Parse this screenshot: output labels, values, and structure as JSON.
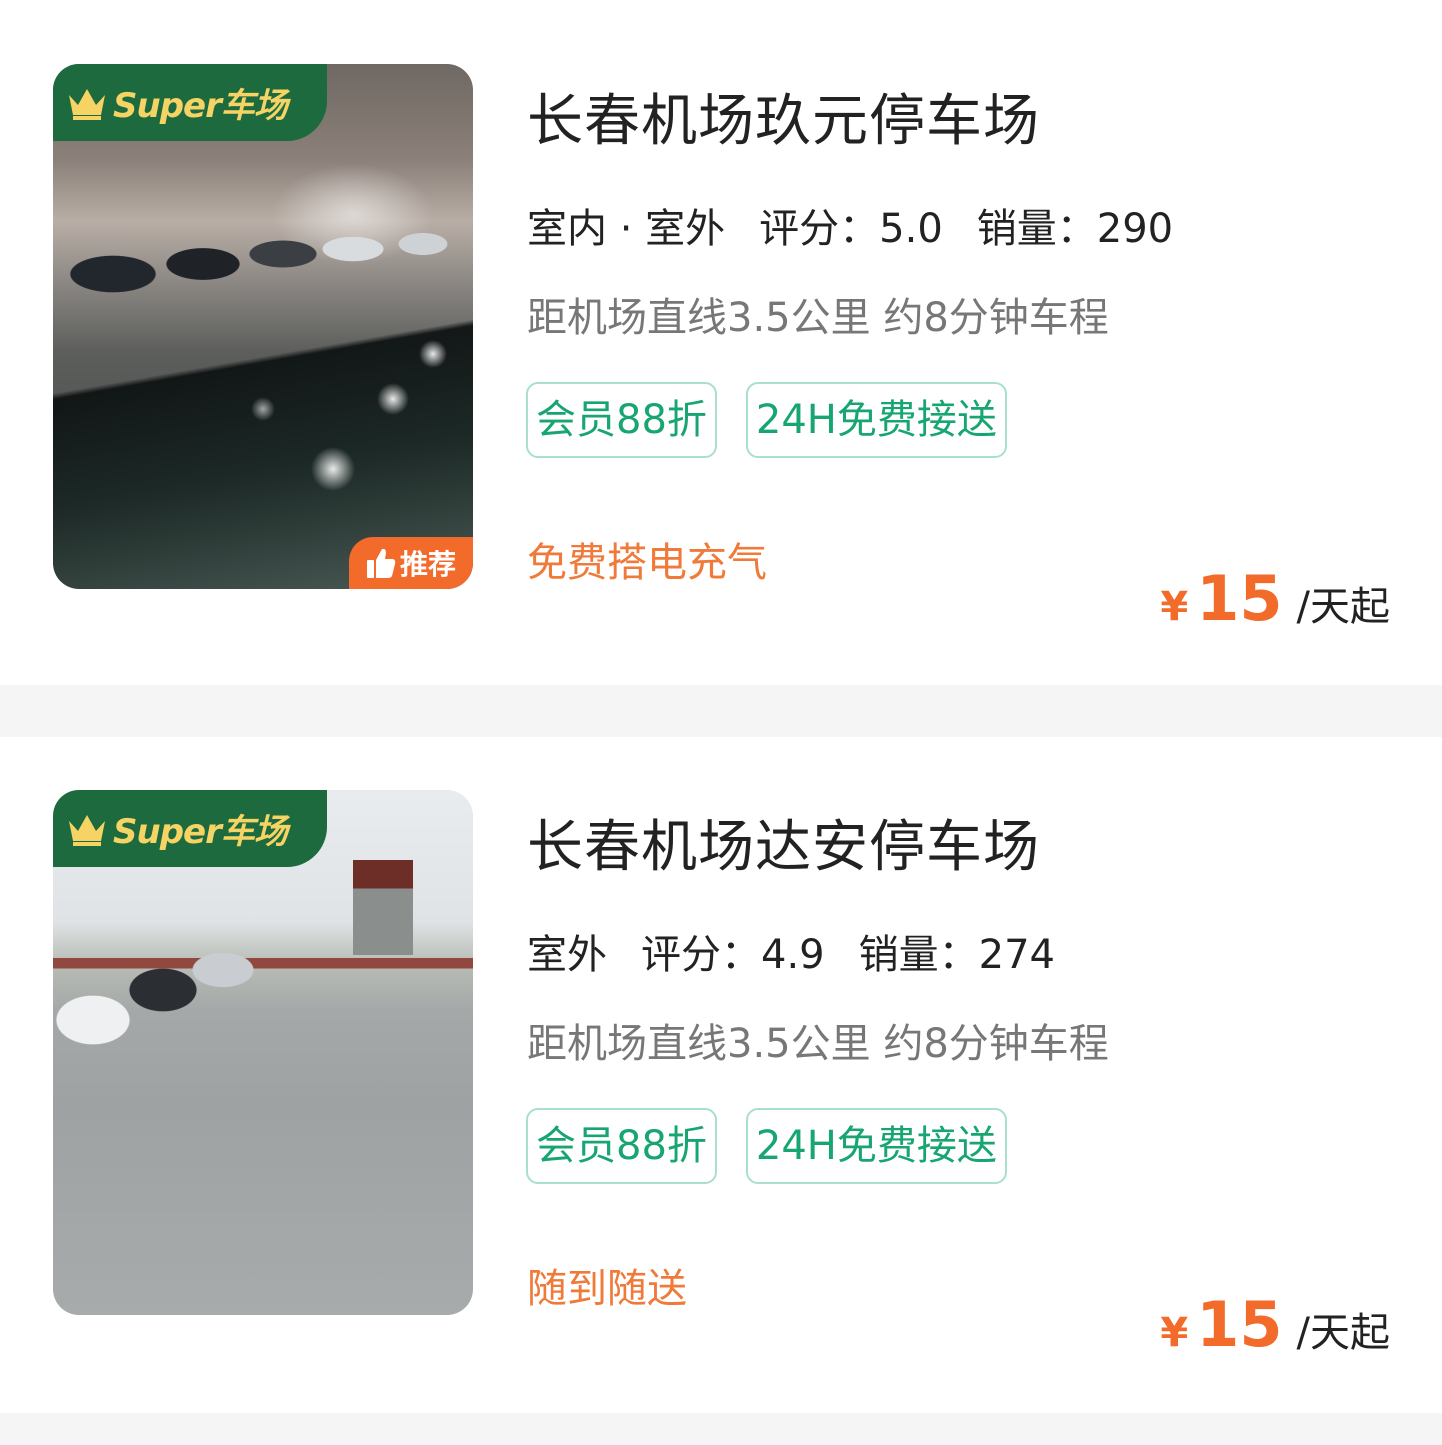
{
  "listings": [
    {
      "badge": "Super车场",
      "recommend": "推荐",
      "name": "长春机场玖元停车场",
      "type": "室内 · 室外",
      "rating": "评分：5.0",
      "sales": "销量：290",
      "distance": "距机场直线3.5公里 约8分钟车程",
      "tags": [
        "会员88折",
        "24H免费接送"
      ],
      "feature": "免费搭电充气",
      "currency": "¥",
      "price": "15",
      "unit": "/天起",
      "photo_icon": "garage-photo"
    },
    {
      "badge": "Super车场",
      "name": "长春机场达安停车场",
      "type": "室外",
      "rating": "评分：4.9",
      "sales": "销量：274",
      "distance": "距机场直线3.5公里 约8分钟车程",
      "tags": [
        "会员88折",
        "24H免费接送"
      ],
      "feature": "随到随送",
      "currency": "¥",
      "price": "15",
      "unit": "/天起",
      "photo_icon": "outdoor-lot-photo"
    }
  ],
  "colors": {
    "accent_orange": "#f26b2b",
    "tag_green": "#17a572",
    "badge_green": "#1c6a3d",
    "badge_gold": "#f6d365"
  }
}
